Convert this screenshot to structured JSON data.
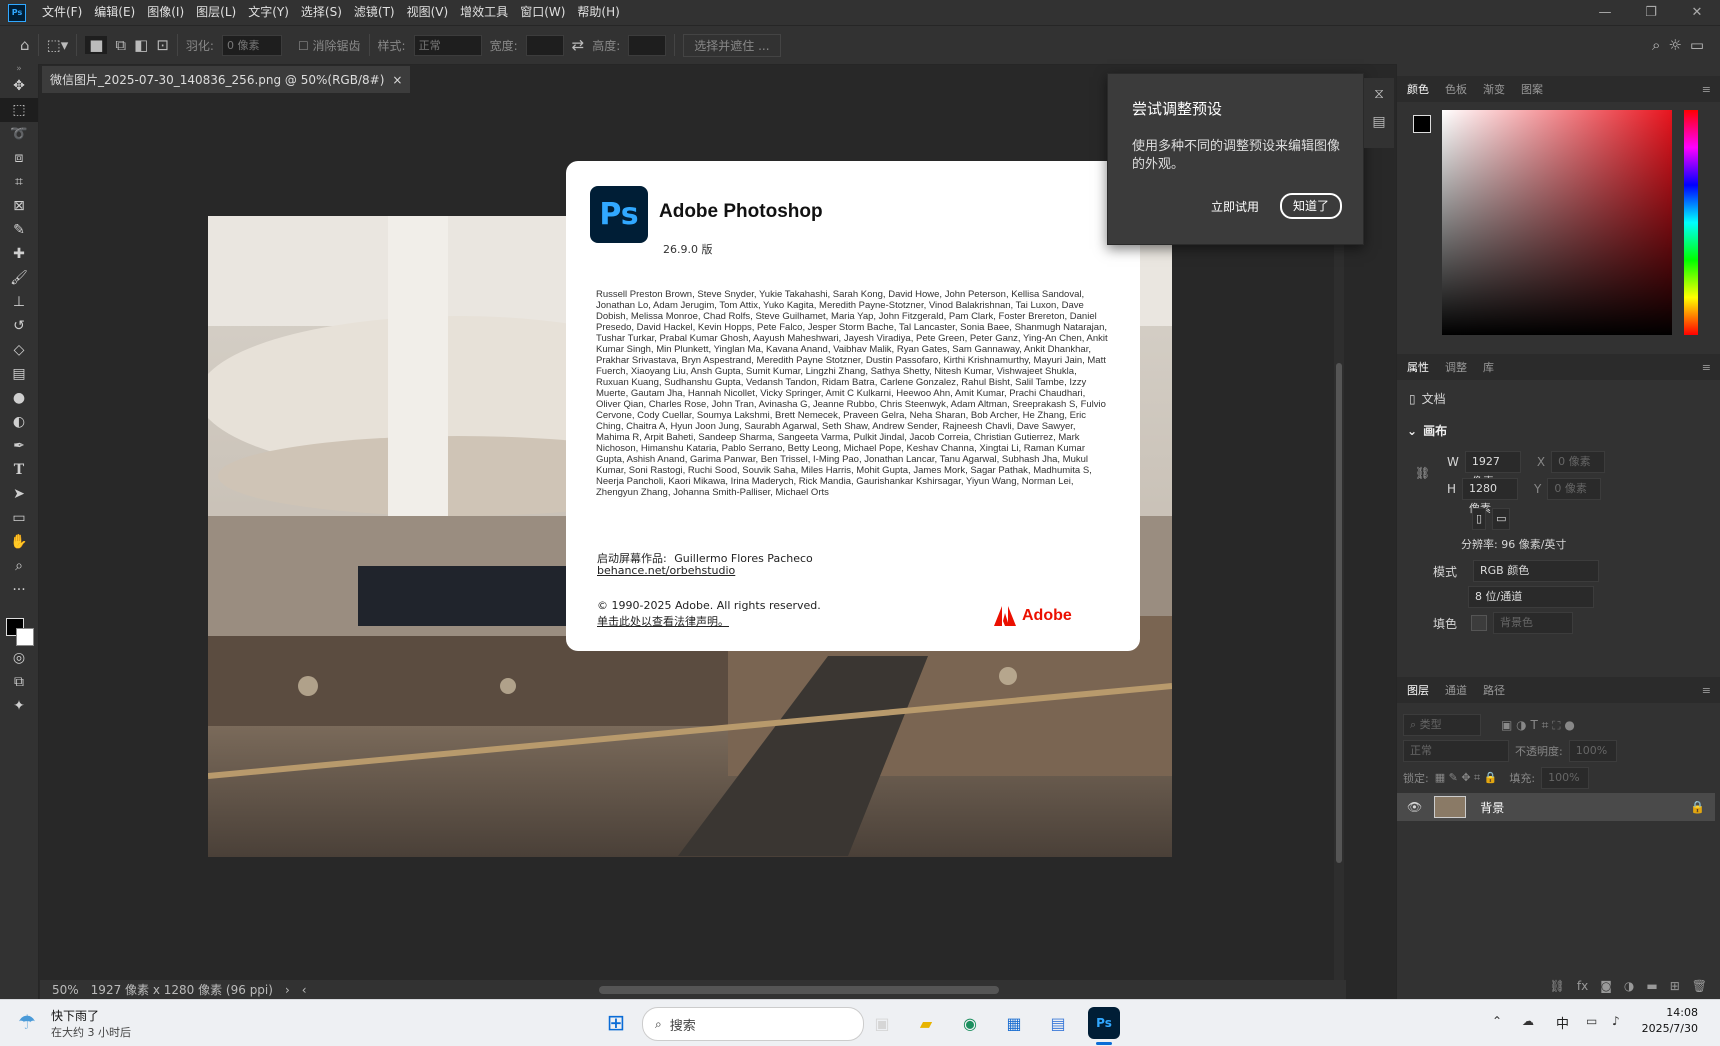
{
  "menubar": {
    "items": [
      "文件(F)",
      "编辑(E)",
      "图像(I)",
      "图层(L)",
      "文字(Y)",
      "选择(S)",
      "滤镜(T)",
      "视图(V)",
      "增效工具",
      "窗口(W)",
      "帮助(H)"
    ],
    "app_icon": "Ps"
  },
  "optionsbar": {
    "feather_label": "羽化:",
    "feather_value": "0 像素",
    "antialias_label": "消除锯齿",
    "style_label": "样式:",
    "style_value": "正常",
    "width_label": "宽度:",
    "height_label": "高度:",
    "select_mask_button": "选择并遮住 ..."
  },
  "document": {
    "tab_title": "微信图片_2025-07-30_140836_256.png @ 50%(RGB/8#)",
    "tab_close": "×"
  },
  "statusbar": {
    "zoom": "50%",
    "info": "1927 像素 x 1280 像素 (96 ppi)"
  },
  "tip_popup": {
    "title": "尝试调整预设",
    "body": "使用多种不同的调整预设来编辑图像的外观。",
    "try_button": "立即试用",
    "dismiss_button": "知道了"
  },
  "about": {
    "logo": "Ps",
    "title": "Adobe Photoshop",
    "version": "26.9.0 版",
    "credits": "Russell Preston Brown, Steve Snyder, Yukie Takahashi, Sarah Kong, David Howe, John Peterson, Kellisa Sandoval, Jonathan Lo, Adam Jerugim, Tom Attix, Yuko Kagita, Meredith Payne-Stotzner, Vinod Balakrishnan, Tai Luxon, Dave Dobish, Melissa Monroe, Chad Rolfs, Steve Guilhamet, Maria Yap, John Fitzgerald, Pam Clark, Foster Brereton, Daniel Presedo, David Hackel, Kevin Hopps, Pete Falco, Jesper Storm Bache, Tal Lancaster, Sonia Baee, Shanmugh Natarajan, Tushar Turkar, Prabal Kumar Ghosh, Aayush Maheshwari, Jayesh Viradiya, Pete Green, Peter Ganz, Ying-An Chen, Ankit Kumar Singh, Min Plunkett, Yinglan Ma, Kavana Anand, Vaibhav Malik, Ryan Gates, Sam Gannaway, Ankit Dhankhar, Prakhar Srivastava, Bryn Aspestrand, Meredith Payne Stotzner, Dustin Passofaro, Kirthi Krishnamurthy, Mayuri Jain, Matt Fuerch, Xiaoyang Liu, Ansh Gupta, Sumit Kumar, Lingzhi Zhang, Sathya Shetty, Nitesh Kumar, Vishwajeet Shukla, Ruxuan Kuang, Sudhanshu Gupta, Vedansh Tandon, Ridam Batra, Carlene Gonzalez, Rahul Bisht, Salil Tambe, Izzy Muerte, Gautam Jha, Hannah Nicollet, Vicky Springer, Amit C Kulkarni, Heewoo Ahn, Amit Kumar, Prachi Chaudhari, Oliver Qian, Charles Rose, John Tran, Avinasha G, Jeanne Rubbo, Chris Steenwyk, Adam Altman, Sreeprakash S, Fulvio Cervone, Cody Cuellar, Soumya Lakshmi, Brett Nemecek, Praveen Gelra, Neha Sharan, Bob Archer, He Zhang, Eric Ching, Chaitra A, Hyun Joon Jung, Saurabh Agarwal, Seth Shaw, Andrew Sender, Rajneesh Chavli, Dave Sawyer, Mahima R, Arpit Baheti, Sandeep Sharma, Sangeeta Varma, Pulkit Jindal, Jacob Correia, Christian Gutierrez, Mark Nichoson, Himanshu Kataria, Pablo Serrano, Betty Leong, Michael Pope, Keshav Channa, Xingtai Li, Raman Kumar Gupta, Ashish Anand, Garima Panwar, Ben Trissel, I-Ming Pao, Jonathan Lancar, Tanu Agarwal, Subhash Jha, Mukul Kumar, Soni Rastogi, Ruchi Sood, Souvik Saha, Miles Harris, Mohit Gupta, James Mork, Sagar Pathak, Madhumita S, Neerja Pancholi, Kaori Mikawa, Irina Maderych, Rick Mandia, Gaurishankar Kshirsagar, Yiyun Wang, Norman Lei, Zhengyun Zhang, Johanna Smith-Palliser, Michael Orts",
    "splash_label": "启动屏幕作品:",
    "splash_artist": "Guillermo Flores Pacheco",
    "splash_link": "behance.net/orbehstudio",
    "copyright": "© 1990-2025 Adobe. All rights reserved.",
    "legal_link": "单击此处以查看法律声明。",
    "adobe_brand": "Adobe"
  },
  "color_panel": {
    "tabs": [
      "颜色",
      "色板",
      "渐变",
      "图案"
    ],
    "hue_color": "#e8141e"
  },
  "properties_panel": {
    "tabs": [
      "属性",
      "调整",
      "库"
    ],
    "doc_label": "文档",
    "section": "画布",
    "w_label": "W",
    "w_value": "1927 像素",
    "x_label": "X",
    "x_value": "0 像素",
    "h_label": "H",
    "h_value": "1280 像素",
    "y_label": "Y",
    "y_value": "0 像素",
    "resolution": "分辨率: 96 像素/英寸",
    "mode_label": "模式",
    "mode_value": "RGB 颜色",
    "depth_value": "8 位/通道",
    "fill_label": "填色",
    "fill_value": "背景色"
  },
  "layers_panel": {
    "tabs": [
      "图层",
      "通道",
      "路径"
    ],
    "filter_placeholder": "类型",
    "blend_mode": "正常",
    "opacity_label": "不透明度:",
    "opacity_value": "100%",
    "lock_label": "锁定:",
    "fill_label": "填充:",
    "fill_value": "100%",
    "layers": [
      {
        "name": "背景"
      }
    ]
  },
  "taskbar": {
    "weather_title": "快下雨了",
    "weather_sub": "在大约 3 小时后",
    "search_placeholder": "搜索",
    "ime": "中",
    "time": "14:08",
    "date": "2025/7/30"
  }
}
